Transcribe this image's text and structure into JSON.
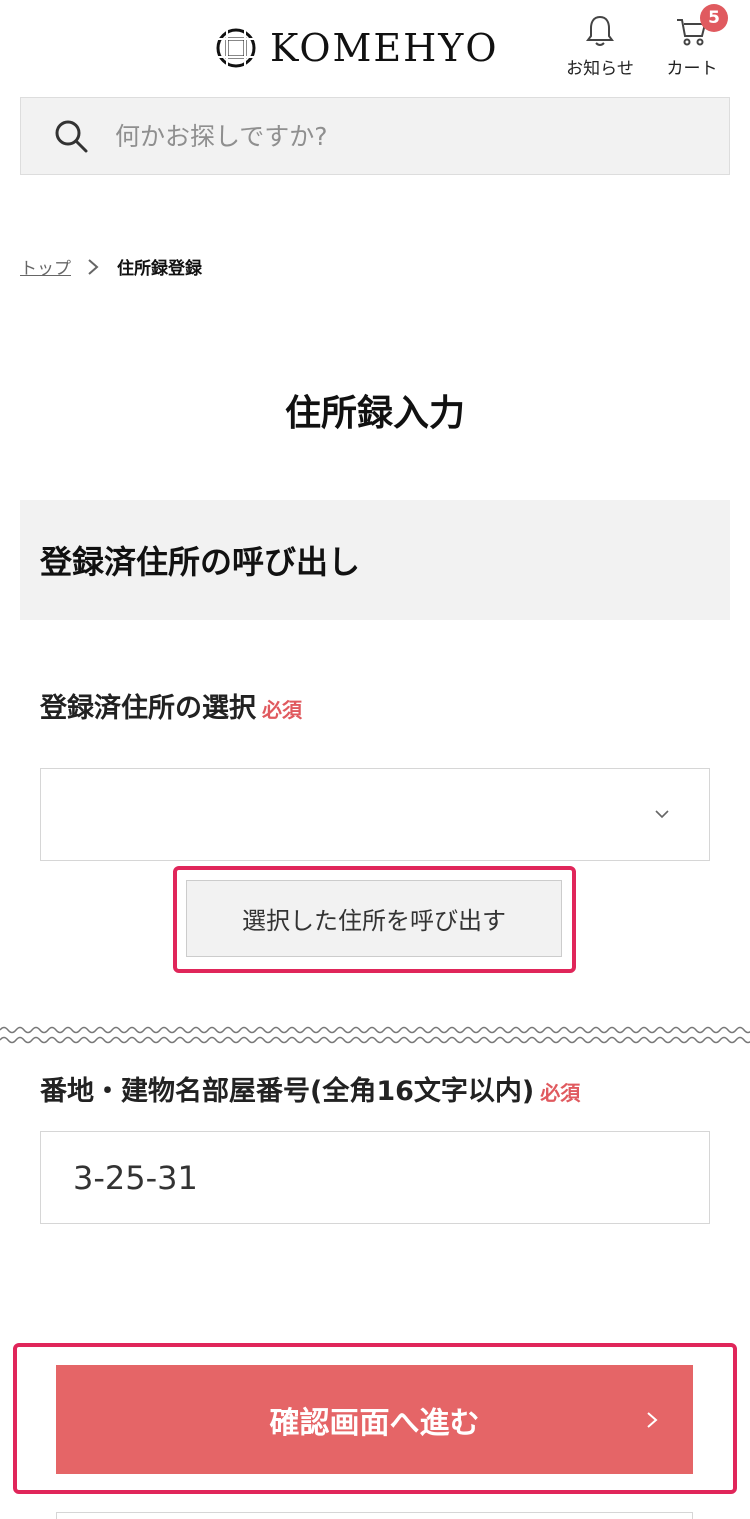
{
  "header": {
    "logo_text": "KOMEHYO",
    "notice_label": "お知らせ",
    "cart_label": "カート",
    "cart_count": "5"
  },
  "search": {
    "placeholder": "何かお探しですか?"
  },
  "breadcrumb": {
    "home": "トップ",
    "separator": ">",
    "current": "住所録登録"
  },
  "page_title": "住所録入力",
  "saved_address": {
    "section_title": "登録済住所の呼び出し",
    "select_label": "登録済住所の選択",
    "required_label": "必須",
    "selected_value": "",
    "call_button": "選択した住所を呼び出す"
  },
  "address_line": {
    "label": "番地・建物名部屋番号(全角16文字以内)",
    "required_label": "必須",
    "value": "3-25-31"
  },
  "confirm_button": "確認画面へ進む",
  "colors": {
    "accent": "#e56567",
    "required": "#e05a5f",
    "highlight": "#e0265a"
  }
}
